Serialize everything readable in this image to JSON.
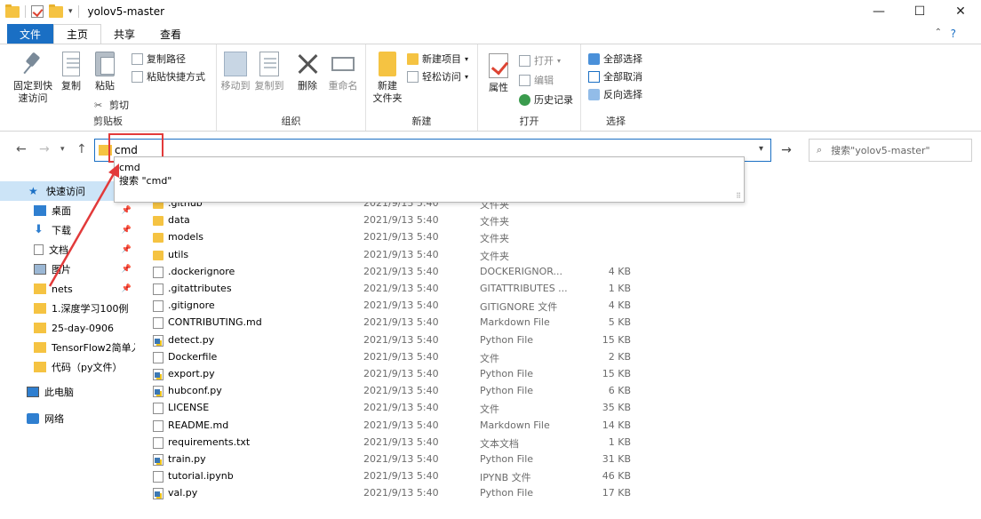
{
  "window": {
    "title": "yolov5-master",
    "minimize": "—",
    "maximize": "☐",
    "close": "✕"
  },
  "tabs": [
    "文件",
    "主页",
    "共享",
    "查看"
  ],
  "ribbon": {
    "clipboard": {
      "pin": "固定到快",
      "pin2": "速访问",
      "copy": "复制",
      "paste": "粘贴",
      "copy_path": "复制路径",
      "paste_shortcut": "粘贴快捷方式",
      "cut": "剪切",
      "label": "剪贴板"
    },
    "organize": {
      "move_to": "移动到",
      "copy_to": "复制到",
      "delete": "删除",
      "rename": "重命名",
      "label": "组织"
    },
    "new": {
      "new_folder": "新建",
      "new_folder2": "文件夹",
      "new_item": "新建项目",
      "easy_access": "轻松访问",
      "label": "新建"
    },
    "open": {
      "properties": "属性",
      "open": "打开",
      "edit": "编辑",
      "history": "历史记录",
      "label": "打开"
    },
    "select": {
      "select_all": "全部选择",
      "select_none": "全部取消",
      "invert": "反向选择",
      "label": "选择"
    }
  },
  "address": {
    "value": "cmd",
    "search_placeholder": "搜索\"yolov5-master\""
  },
  "dropdown": {
    "suggestion": "cmd",
    "search": "搜索 \"cmd\""
  },
  "sidebar": [
    {
      "label": "快速访问",
      "icon": "star-icon"
    },
    {
      "label": "桌面",
      "icon": "desktop-icon",
      "pinned": true
    },
    {
      "label": "下载",
      "icon": "download-icon",
      "pinned": true
    },
    {
      "label": "文档",
      "icon": "documents-icon",
      "pinned": true
    },
    {
      "label": "图片",
      "icon": "pictures-icon",
      "pinned": true
    },
    {
      "label": "nets",
      "icon": "folder-icon",
      "pinned": true
    },
    {
      "label": "1.深度学习100例",
      "icon": "folder-icon"
    },
    {
      "label": "25-day-0906",
      "icon": "folder-icon"
    },
    {
      "label": "TensorFlow2简单入",
      "icon": "folder-icon"
    },
    {
      "label": "代码（py文件）",
      "icon": "folder-icon"
    },
    {
      "label": "此电脑",
      "icon": "computer-icon"
    },
    {
      "label": "网络",
      "icon": "network-icon"
    }
  ],
  "files": [
    {
      "name": ".github",
      "date": "2021/9/13 5:40",
      "type": "文件夹",
      "size": "",
      "kind": "folder"
    },
    {
      "name": "data",
      "date": "2021/9/13 5:40",
      "type": "文件夹",
      "size": "",
      "kind": "folder"
    },
    {
      "name": "models",
      "date": "2021/9/13 5:40",
      "type": "文件夹",
      "size": "",
      "kind": "folder"
    },
    {
      "name": "utils",
      "date": "2021/9/13 5:40",
      "type": "文件夹",
      "size": "",
      "kind": "folder"
    },
    {
      "name": ".dockerignore",
      "date": "2021/9/13 5:40",
      "type": "DOCKERIGNOR...",
      "size": "4 KB",
      "kind": "file"
    },
    {
      "name": ".gitattributes",
      "date": "2021/9/13 5:40",
      "type": "GITATTRIBUTES ...",
      "size": "1 KB",
      "kind": "file"
    },
    {
      "name": ".gitignore",
      "date": "2021/9/13 5:40",
      "type": "GITIGNORE 文件",
      "size": "4 KB",
      "kind": "file"
    },
    {
      "name": "CONTRIBUTING.md",
      "date": "2021/9/13 5:40",
      "type": "Markdown File",
      "size": "5 KB",
      "kind": "file"
    },
    {
      "name": "detect.py",
      "date": "2021/9/13 5:40",
      "type": "Python File",
      "size": "15 KB",
      "kind": "py"
    },
    {
      "name": "Dockerfile",
      "date": "2021/9/13 5:40",
      "type": "文件",
      "size": "2 KB",
      "kind": "file"
    },
    {
      "name": "export.py",
      "date": "2021/9/13 5:40",
      "type": "Python File",
      "size": "15 KB",
      "kind": "py"
    },
    {
      "name": "hubconf.py",
      "date": "2021/9/13 5:40",
      "type": "Python File",
      "size": "6 KB",
      "kind": "py"
    },
    {
      "name": "LICENSE",
      "date": "2021/9/13 5:40",
      "type": "文件",
      "size": "35 KB",
      "kind": "file"
    },
    {
      "name": "README.md",
      "date": "2021/9/13 5:40",
      "type": "Markdown File",
      "size": "14 KB",
      "kind": "file"
    },
    {
      "name": "requirements.txt",
      "date": "2021/9/13 5:40",
      "type": "文本文档",
      "size": "1 KB",
      "kind": "file"
    },
    {
      "name": "train.py",
      "date": "2021/9/13 5:40",
      "type": "Python File",
      "size": "31 KB",
      "kind": "py"
    },
    {
      "name": "tutorial.ipynb",
      "date": "2021/9/13 5:40",
      "type": "IPYNB 文件",
      "size": "46 KB",
      "kind": "file"
    },
    {
      "name": "val.py",
      "date": "2021/9/13 5:40",
      "type": "Python File",
      "size": "17 KB",
      "kind": "py"
    }
  ],
  "colors": {
    "accent": "#1a6fc4",
    "highlight": "#e23a3a",
    "selected": "#cce4f7"
  }
}
